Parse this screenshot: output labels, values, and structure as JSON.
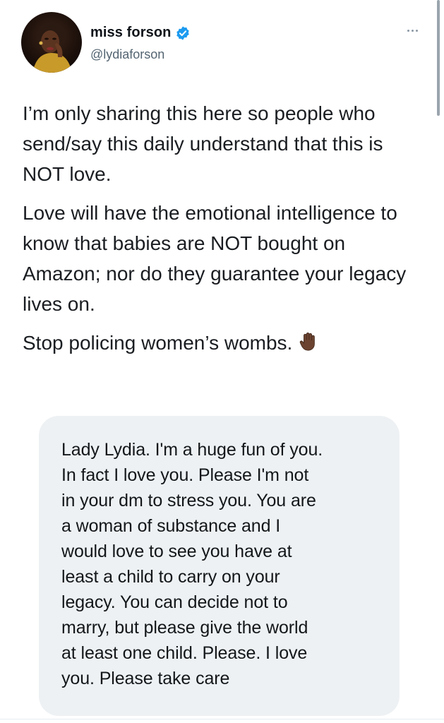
{
  "author": {
    "display_name": "miss forson",
    "handle": "@lydiaforson",
    "verified": true,
    "avatar_icon": "profile-photo",
    "verified_icon": "verified-badge-icon",
    "verified_color": "#1d9bf0"
  },
  "menu": {
    "more_icon": "more-options-icon"
  },
  "tweet": {
    "paragraphs": [
      "I’m only sharing this here so people who send/say this daily understand that this is NOT love.",
      "Love will have the emotional intelligence to know that babies are NOT bought on Amazon; nor do they guarantee your legacy lives on.",
      "Stop policing women’s wombs."
    ],
    "emoji": "raised-hand-dark-skin-tone"
  },
  "dm_screenshot": {
    "text": "Lady Lydia. I'm a huge fun of you.\nIn fact I love you.  Please I'm not\nin your dm to stress you.  You are\na woman of substance and I\nwould love to see you have at\nleast a child to carry on your\nlegacy. You can decide not to\nmarry,  but please give the world\nat least one child.  Please.  I love\nyou.  Please take care",
    "bubble_color": "#eef1f3"
  }
}
